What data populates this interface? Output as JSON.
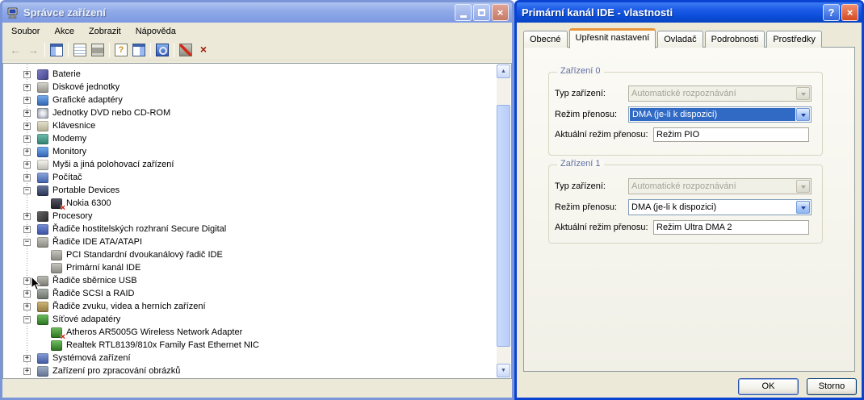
{
  "left_window": {
    "title": "Správce zařízení",
    "menu": [
      "Soubor",
      "Akce",
      "Zobrazit",
      "Nápověda"
    ],
    "toolbar_groups": [
      [
        "back",
        "forward"
      ],
      [
        "show-console-tree"
      ],
      [
        "properties",
        "print"
      ],
      [
        "help",
        "show-action-pane"
      ],
      [
        "scan-hardware-changes"
      ],
      [
        "disable-device",
        "uninstall-device"
      ]
    ],
    "tree": [
      {
        "label": "Baterie",
        "level": 1,
        "expander": "+",
        "icon": "battery-icon",
        "disabled": false
      },
      {
        "label": "Diskové jednotky",
        "level": 1,
        "expander": "+",
        "icon": "disk-drive-icon",
        "disabled": false
      },
      {
        "label": "Grafické adaptéry",
        "level": 1,
        "expander": "+",
        "icon": "display-adapter-icon",
        "disabled": false
      },
      {
        "label": "Jednotky DVD nebo CD-ROM",
        "level": 1,
        "expander": "+",
        "icon": "cd-drive-icon",
        "disabled": false
      },
      {
        "label": "Klávesnice",
        "level": 1,
        "expander": "+",
        "icon": "keyboard-icon",
        "disabled": false
      },
      {
        "label": "Modemy",
        "level": 1,
        "expander": "+",
        "icon": "modem-icon",
        "disabled": false
      },
      {
        "label": "Monitory",
        "level": 1,
        "expander": "+",
        "icon": "monitor-icon",
        "disabled": false
      },
      {
        "label": "Myši a jiná polohovací zařízení",
        "level": 1,
        "expander": "+",
        "icon": "mouse-icon",
        "disabled": false
      },
      {
        "label": "Počítač",
        "level": 1,
        "expander": "+",
        "icon": "computer-icon",
        "disabled": false
      },
      {
        "label": "Portable Devices",
        "level": 1,
        "expander": "−",
        "icon": "portable-device-icon",
        "disabled": false
      },
      {
        "label": "Nokia 6300",
        "level": 2,
        "expander": null,
        "icon": "phone-icon",
        "disabled": true
      },
      {
        "label": "Procesory",
        "level": 1,
        "expander": "+",
        "icon": "processor-icon",
        "disabled": false
      },
      {
        "label": "Řadiče hostitelských rozhraní Secure Digital",
        "level": 1,
        "expander": "+",
        "icon": "sd-host-icon",
        "disabled": false
      },
      {
        "label": "Řadiče IDE ATA/ATAPI",
        "level": 1,
        "expander": "−",
        "icon": "ide-controller-icon",
        "disabled": false
      },
      {
        "label": "PCI Standardní dvoukanálový řadič IDE",
        "level": 2,
        "expander": null,
        "icon": "ide-controller-icon",
        "disabled": false
      },
      {
        "label": "Primární kanál IDE",
        "level": 2,
        "expander": null,
        "icon": "ide-controller-icon",
        "disabled": false
      },
      {
        "label": "Řadiče sběrnice USB",
        "level": 1,
        "expander": "+",
        "icon": "usb-icon",
        "disabled": false
      },
      {
        "label": "Řadiče SCSI a RAID",
        "level": 1,
        "expander": "+",
        "icon": "scsi-icon",
        "disabled": false
      },
      {
        "label": "Řadiče zvuku, videa a herních zařízení",
        "level": 1,
        "expander": "+",
        "icon": "sound-icon",
        "disabled": false
      },
      {
        "label": "Síťové adapatéry",
        "level": 1,
        "expander": "−",
        "icon": "network-adapter-icon",
        "disabled": false
      },
      {
        "label": "Atheros AR5005G Wireless Network Adapter",
        "level": 2,
        "expander": null,
        "icon": "network-adapter-icon",
        "disabled": true
      },
      {
        "label": "Realtek RTL8139/810x Family Fast Ethernet NIC",
        "level": 2,
        "expander": null,
        "icon": "network-adapter-icon",
        "disabled": false
      },
      {
        "label": "Systémová zařízení",
        "level": 1,
        "expander": "+",
        "icon": "system-device-icon",
        "disabled": false
      },
      {
        "label": "Zařízení pro zpracování obrázků",
        "level": 1,
        "expander": "+",
        "icon": "imaging-icon",
        "disabled": false
      }
    ]
  },
  "dialog": {
    "title": "Primární kanál IDE - vlastnosti",
    "tabs": [
      "Obecné",
      "Upřesnit nastavení",
      "Ovladač",
      "Podrobnosti",
      "Prostředky"
    ],
    "active_tab": 1,
    "groups": [
      {
        "caption": "Zařízení 0",
        "rows": [
          {
            "label": "Typ zařízení:",
            "control": "combo-disabled",
            "value": "Automatické rozpoznávání"
          },
          {
            "label": "Režim přenosu:",
            "control": "combo-selected",
            "value": "DMA (je-li k dispozici)"
          },
          {
            "label": "Aktuální režim přenosu:",
            "control": "textbox",
            "value": "Režim PIO"
          }
        ]
      },
      {
        "caption": "Zařízení 1",
        "rows": [
          {
            "label": "Typ zařízení:",
            "control": "combo-disabled",
            "value": "Automatické rozpoznávání"
          },
          {
            "label": "Režim přenosu:",
            "control": "combo",
            "value": "DMA (je-li k dispozici)"
          },
          {
            "label": "Aktuální režim přenosu:",
            "control": "textbox",
            "value": "Režim Ultra DMA 2"
          }
        ]
      }
    ],
    "buttons": [
      {
        "label": "OK",
        "focused": true
      },
      {
        "label": "Storno",
        "focused": false
      }
    ]
  },
  "colors": {
    "selection_blue": "#316AC5",
    "active_title_blue": "#0B4CD8",
    "inactive_title_blue": "#8FA9E8",
    "tab_accent_orange": "#E7953A",
    "window_chrome_beige": "#ECE9D8"
  }
}
